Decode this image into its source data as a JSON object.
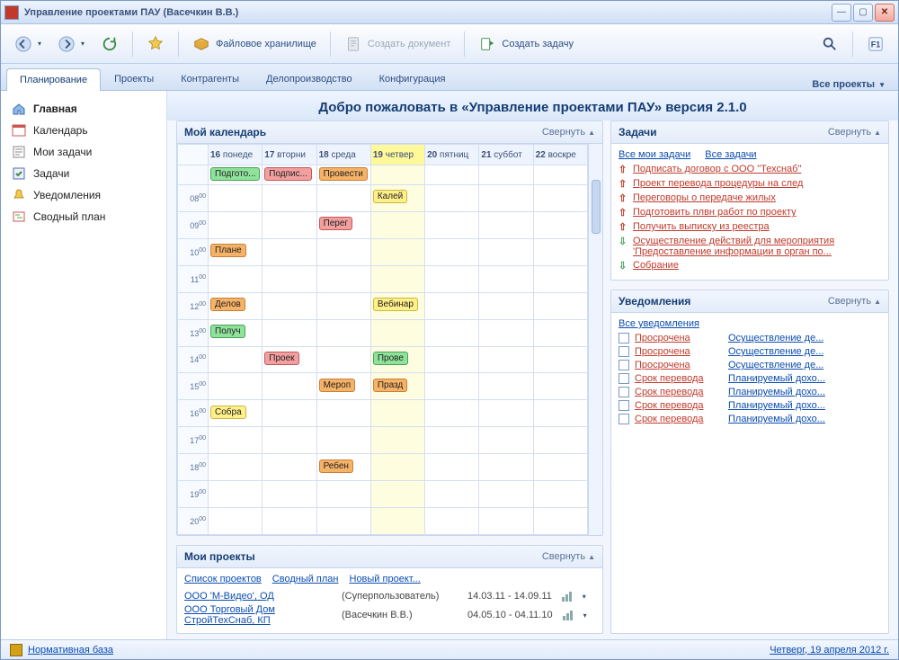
{
  "window": {
    "title": "Управление проектами ПАУ (Васечкин В.В.)"
  },
  "toolbar": {
    "file_storage": "Файловое хранилище",
    "create_doc": "Создать документ",
    "create_task": "Создать задачу"
  },
  "tabs": {
    "items": [
      "Планирование",
      "Проекты",
      "Контрагенты",
      "Делопроизводство",
      "Конфигурация"
    ],
    "all_projects": "Все проекты"
  },
  "sidebar": {
    "items": [
      {
        "label": "Главная",
        "icon": "home"
      },
      {
        "label": "Календарь",
        "icon": "calendar"
      },
      {
        "label": "Мои задачи",
        "icon": "my-tasks"
      },
      {
        "label": "Задачи",
        "icon": "tasks"
      },
      {
        "label": "Уведомления",
        "icon": "bell"
      },
      {
        "label": "Сводный план",
        "icon": "plan"
      }
    ]
  },
  "welcome": "Добро пожаловать в «Управление проектами ПАУ» версия 2.1.0",
  "collapse": "Свернуть",
  "calendar": {
    "title": "Мой календарь",
    "days": [
      {
        "num": "16",
        "name": "понеде"
      },
      {
        "num": "17",
        "name": "вторни"
      },
      {
        "num": "18",
        "name": "среда"
      },
      {
        "num": "19",
        "name": "четвер"
      },
      {
        "num": "20",
        "name": "пятниц"
      },
      {
        "num": "21",
        "name": "суббот"
      },
      {
        "num": "22",
        "name": "воскре"
      }
    ],
    "hours": [
      "08",
      "09",
      "10",
      "11",
      "12",
      "13",
      "14",
      "15",
      "16",
      "17",
      "18",
      "19",
      "20"
    ],
    "allday": [
      {
        "col": 0,
        "color": "green",
        "text": "Подгото..."
      },
      {
        "col": 1,
        "color": "red",
        "text": "Подпис..."
      },
      {
        "col": 2,
        "color": "orange",
        "text": "Провести"
      }
    ],
    "events": [
      {
        "row": 0,
        "col": 3,
        "color": "yellow",
        "text": "Калей"
      },
      {
        "row": 1,
        "col": 2,
        "color": "red",
        "text": "Перег"
      },
      {
        "row": 2,
        "col": 0,
        "color": "orange",
        "text": "Плане"
      },
      {
        "row": 4,
        "col": 0,
        "color": "orange",
        "text": "Делов"
      },
      {
        "row": 4,
        "col": 3,
        "color": "yellow",
        "text": "Вебинар"
      },
      {
        "row": 5,
        "col": 0,
        "color": "green",
        "text": "Получ"
      },
      {
        "row": 6,
        "col": 1,
        "color": "red",
        "text": "Проек"
      },
      {
        "row": 6,
        "col": 3,
        "color": "green",
        "text": "Прове"
      },
      {
        "row": 7,
        "col": 2,
        "color": "orange",
        "text": "Мероп"
      },
      {
        "row": 7,
        "col": 3,
        "color": "orange",
        "text": "Празд"
      },
      {
        "row": 8,
        "col": 0,
        "color": "yellow",
        "text": "Собра"
      },
      {
        "row": 10,
        "col": 2,
        "color": "orange",
        "text": "Ребен"
      }
    ]
  },
  "projects": {
    "title": "Мои проекты",
    "links": {
      "list": "Список проектов",
      "summary": "Сводный план",
      "new": "Новый проект..."
    },
    "rows": [
      {
        "name": "ООО 'М-Видео', ОД",
        "owner": "(Суперпользователь)",
        "dates": "14.03.11 - 14.09.11"
      },
      {
        "name": "ООО Торговый Дом СтройТехСнаб, КП",
        "owner": "(Васечкин В.В.)",
        "dates": "04.05.10 - 04.11.10"
      }
    ]
  },
  "tasks": {
    "title": "Задачи",
    "links": {
      "mine": "Все мои задачи",
      "all": "Все задачи"
    },
    "items": [
      {
        "dir": "up",
        "text": "Подписать договор с ООО \"Техснаб\""
      },
      {
        "dir": "up",
        "text": "Проект перевода процедуры на след"
      },
      {
        "dir": "up",
        "text": "Переговоры о передаче жилых"
      },
      {
        "dir": "up",
        "text": "Подготовить плвн работ по проекту"
      },
      {
        "dir": "up",
        "text": "Получить выписку из реестра"
      },
      {
        "dir": "down",
        "text": "Осуществление действий для мероприятия 'Предоставление информации в орган по..."
      },
      {
        "dir": "down",
        "text": "Собрание"
      }
    ]
  },
  "notifications": {
    "title": "Уведомления",
    "all": "Все уведомления",
    "rows": [
      {
        "status": "Просрочена",
        "desc": "Осуществление де..."
      },
      {
        "status": "Просрочена",
        "desc": "Осуществление де..."
      },
      {
        "status": "Просрочена",
        "desc": "Осуществление де..."
      },
      {
        "status": "Срок перевода",
        "desc": "Планируемый дохо..."
      },
      {
        "status": "Срок перевода",
        "desc": "Планируемый дохо..."
      },
      {
        "status": "Срок перевода",
        "desc": "Планируемый дохо..."
      },
      {
        "status": "Срок перевода",
        "desc": "Планируемый дохо..."
      }
    ]
  },
  "footer": {
    "left": "Нормативная база",
    "right": "Четверг, 19 апреля 2012 г."
  }
}
